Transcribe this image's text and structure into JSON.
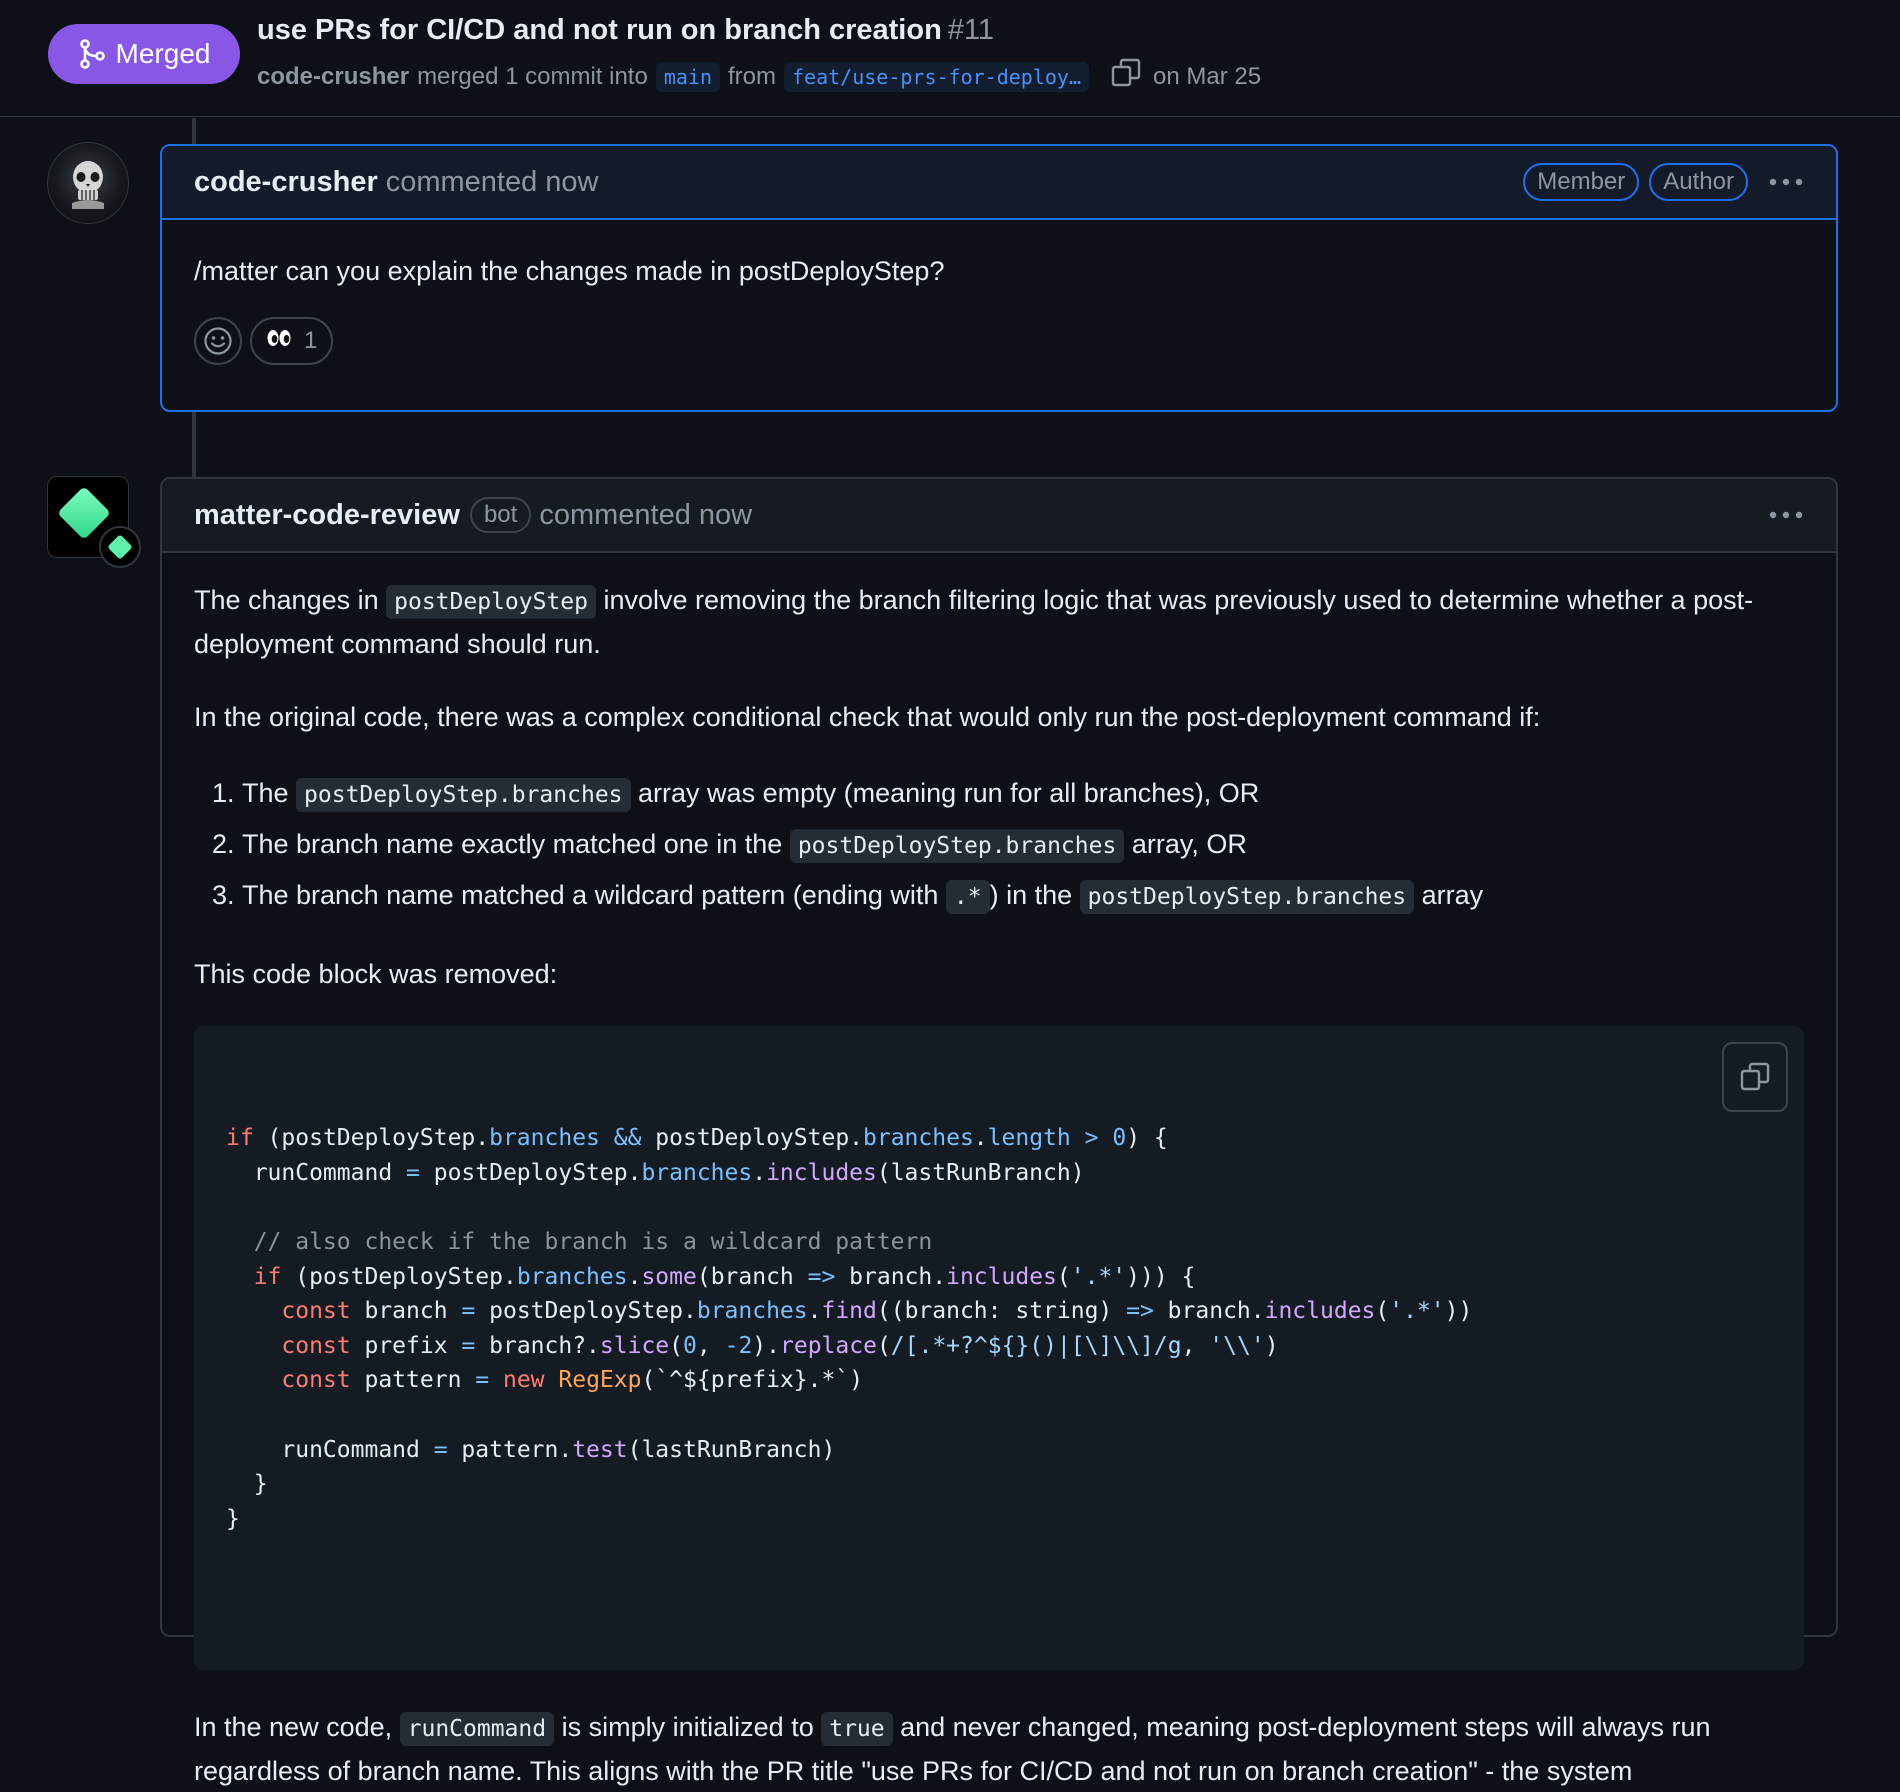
{
  "pr": {
    "status_label": "Merged",
    "title": "use PRs for CI/CD and not run on branch creation",
    "number": "#11",
    "author": "code-crusher",
    "merge_text": "merged 1 commit into",
    "base_branch": "main",
    "from_text": "from",
    "head_branch": "feat/use-prs-for-deploy…",
    "date_text": "on Mar 25"
  },
  "comment1": {
    "author": "code-crusher",
    "action": "commented now",
    "roles": [
      "Member",
      "Author"
    ],
    "body": "/matter can you explain the changes made in postDeployStep?",
    "reaction_emoji": "👀",
    "reaction_count": "1"
  },
  "comment2": {
    "author": "matter-code-review",
    "bot_label": "bot",
    "action": "commented now",
    "p1": {
      "before": "The changes in ",
      "code": "postDeployStep",
      "after": " involve removing the branch filtering logic that was previously used to determine whether a post-deployment command should run."
    },
    "p2": "In the original code, there was a complex conditional check that would only run the post-deployment command if:",
    "list": [
      {
        "before": "The ",
        "code": "postDeployStep.branches",
        "after": " array was empty (meaning run for all branches), OR"
      },
      {
        "before": "The branch name exactly matched one in the ",
        "code": "postDeployStep.branches",
        "after": " array, OR"
      },
      {
        "before": "The branch name matched a wildcard pattern (ending with ",
        "code": ".*",
        "middle": ") in the ",
        "code2": "postDeployStep.branches",
        "after": " array"
      }
    ],
    "p3": "This code block was removed:",
    "code_lines": [
      [
        [
          "kw",
          "if"
        ],
        [
          "pl",
          " (postDeployStep."
        ],
        [
          "prop",
          "branches"
        ],
        [
          "pl",
          " "
        ],
        [
          "op",
          "&&"
        ],
        [
          "pl",
          " postDeployStep."
        ],
        [
          "prop",
          "branches"
        ],
        [
          "pl",
          "."
        ],
        [
          "prop",
          "length"
        ],
        [
          "pl",
          " "
        ],
        [
          "op",
          ">"
        ],
        [
          "pl",
          " "
        ],
        [
          "num",
          "0"
        ],
        [
          "pl",
          ") {"
        ]
      ],
      [
        [
          "pl",
          "  runCommand "
        ],
        [
          "op",
          "="
        ],
        [
          "pl",
          " postDeployStep."
        ],
        [
          "prop",
          "branches"
        ],
        [
          "pl",
          "."
        ],
        [
          "fn",
          "includes"
        ],
        [
          "pl",
          "(lastRunBranch)"
        ]
      ],
      [],
      [
        [
          "cmt",
          "  // also check if the branch is a wildcard pattern"
        ]
      ],
      [
        [
          "pl",
          "  "
        ],
        [
          "kw",
          "if"
        ],
        [
          "pl",
          " (postDeployStep."
        ],
        [
          "prop",
          "branches"
        ],
        [
          "pl",
          "."
        ],
        [
          "fn",
          "some"
        ],
        [
          "pl",
          "(branch "
        ],
        [
          "op",
          "=>"
        ],
        [
          "pl",
          " branch."
        ],
        [
          "fn",
          "includes"
        ],
        [
          "pl",
          "("
        ],
        [
          "str",
          "'.*'"
        ],
        [
          "pl",
          "))) {"
        ]
      ],
      [
        [
          "pl",
          "    "
        ],
        [
          "kw",
          "const"
        ],
        [
          "pl",
          " branch "
        ],
        [
          "op",
          "="
        ],
        [
          "pl",
          " postDeployStep."
        ],
        [
          "prop",
          "branches"
        ],
        [
          "pl",
          "."
        ],
        [
          "fn",
          "find"
        ],
        [
          "pl",
          "((branch: string) "
        ],
        [
          "op",
          "=>"
        ],
        [
          "pl",
          " branch."
        ],
        [
          "fn",
          "includes"
        ],
        [
          "pl",
          "("
        ],
        [
          "str",
          "'.*'"
        ],
        [
          "pl",
          "))"
        ]
      ],
      [
        [
          "pl",
          "    "
        ],
        [
          "kw",
          "const"
        ],
        [
          "pl",
          " prefix "
        ],
        [
          "op",
          "="
        ],
        [
          "pl",
          " branch?."
        ],
        [
          "fn",
          "slice"
        ],
        [
          "pl",
          "("
        ],
        [
          "num",
          "0"
        ],
        [
          "pl",
          ", "
        ],
        [
          "op",
          "-"
        ],
        [
          "num",
          "2"
        ],
        [
          "pl",
          ")."
        ],
        [
          "fn",
          "replace"
        ],
        [
          "pl",
          "("
        ],
        [
          "str",
          "/[.*+?^${}()|[\\]\\\\]/g"
        ],
        [
          "pl",
          ", "
        ],
        [
          "str",
          "'\\\\'"
        ],
        [
          "pl",
          ")"
        ]
      ],
      [
        [
          "pl",
          "    "
        ],
        [
          "kw",
          "const"
        ],
        [
          "pl",
          " pattern "
        ],
        [
          "op",
          "="
        ],
        [
          "pl",
          " "
        ],
        [
          "kw",
          "new"
        ],
        [
          "pl",
          " "
        ],
        [
          "cls",
          "RegExp"
        ],
        [
          "pl",
          "(`^${prefix}.*`)"
        ]
      ],
      [],
      [
        [
          "pl",
          "    runCommand "
        ],
        [
          "op",
          "="
        ],
        [
          "pl",
          " pattern."
        ],
        [
          "fn",
          "test"
        ],
        [
          "pl",
          "(lastRunBranch)"
        ]
      ],
      [
        [
          "pl",
          "  }"
        ]
      ],
      [
        [
          "pl",
          "}"
        ]
      ]
    ],
    "p4": {
      "before": "In the new code, ",
      "code": "runCommand",
      "middle": " is simply initialized to ",
      "code2": "true",
      "after": " and never changed, meaning post-deployment steps will always run regardless of branch name. This aligns with the PR title \"use PRs for CI/CD and not run on branch creation\" - the system"
    }
  },
  "colors": {
    "merged": "#8957e5",
    "accent": "#1f6feb",
    "link": "#4493f8",
    "background": "#0d1117"
  },
  "icons": [
    "git-merge-icon",
    "copy-icon",
    "kebab-icon",
    "smiley-icon",
    "avatar-skull",
    "bot-logo"
  ]
}
